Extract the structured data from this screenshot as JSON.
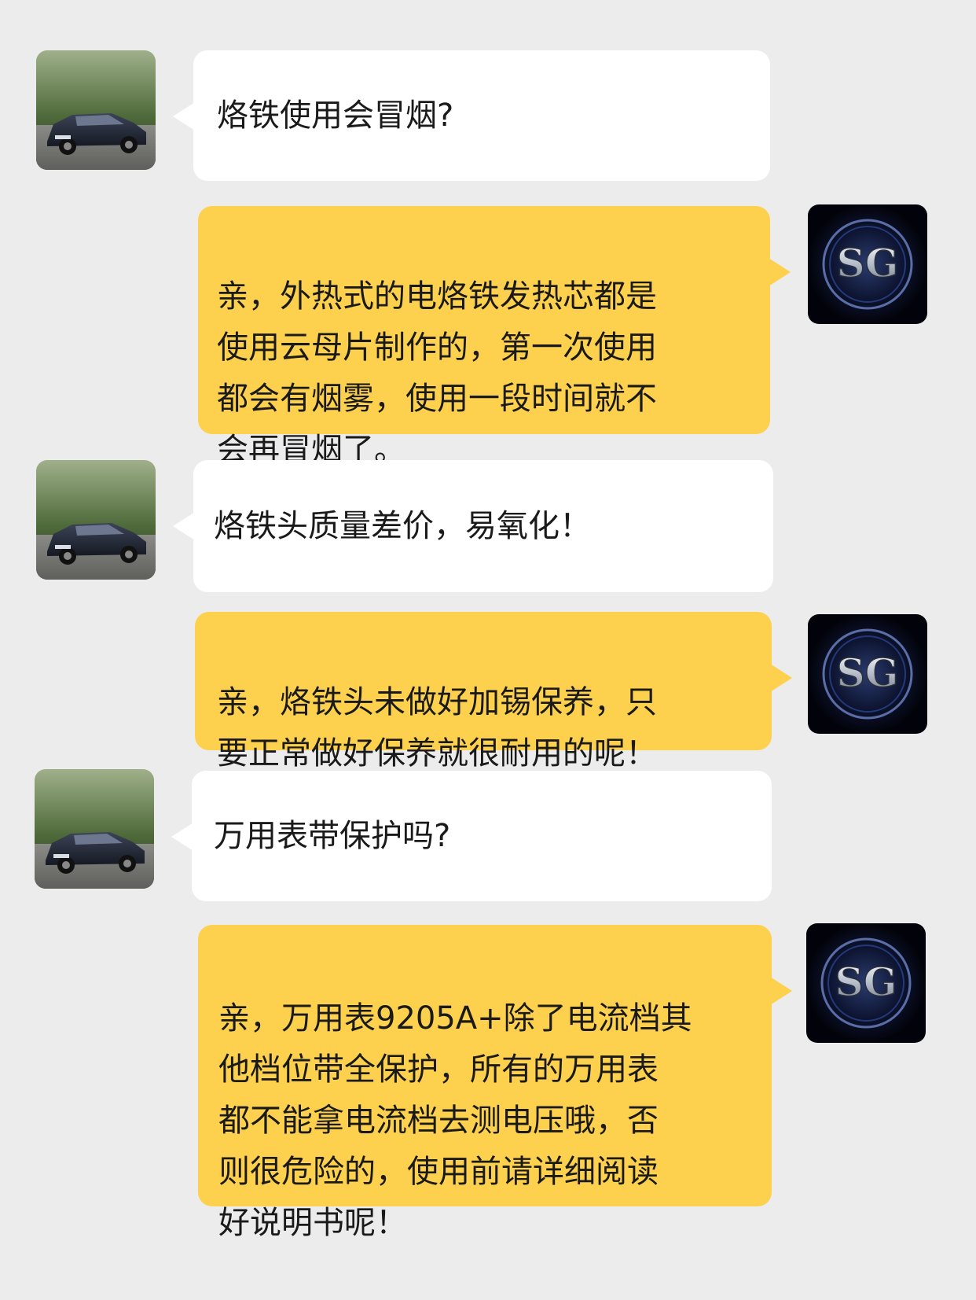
{
  "colors": {
    "background": "#ececec",
    "user_bubble": "#ffffff",
    "agent_bubble": "#fdd14d",
    "text": "#1a1a1a"
  },
  "agent_avatar_logo": "SG",
  "messages": [
    {
      "sender": "customer",
      "avatar": "car-photo",
      "text": "烙铁使用会冒烟?"
    },
    {
      "sender": "agent",
      "avatar": "sg-logo",
      "text": "亲，外热式的电烙铁发热芯都是\n使用云母片制作的，第一次使用\n都会有烟雾，使用一段时间就不\n会再冒烟了。"
    },
    {
      "sender": "customer",
      "avatar": "car-photo",
      "text": "烙铁头质量差价，易氧化！"
    },
    {
      "sender": "agent",
      "avatar": "sg-logo",
      "text": "亲，烙铁头未做好加锡保养，只\n要正常做好保养就很耐用的呢！"
    },
    {
      "sender": "customer",
      "avatar": "car-photo",
      "text": "万用表带保护吗?"
    },
    {
      "sender": "agent",
      "avatar": "sg-logo",
      "text": "亲，万用表9205A+除了电流档其\n他档位带全保护，所有的万用表\n都不能拿电流档去测电压哦，否\n则很危险的，使用前请详细阅读\n好说明书呢！"
    }
  ]
}
